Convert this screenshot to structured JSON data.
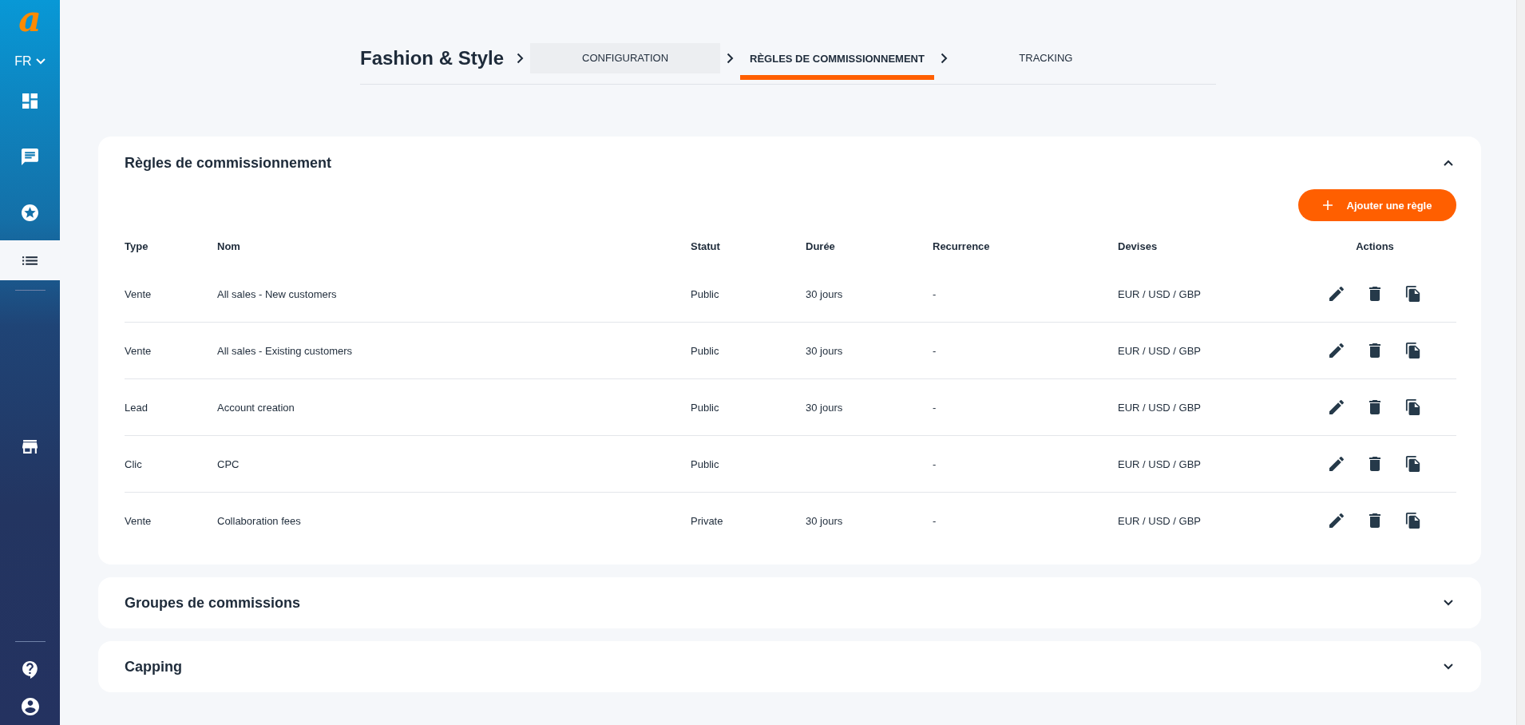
{
  "sidebar": {
    "logo": "a",
    "language": "FR",
    "nav": [
      {
        "selected": false
      },
      {
        "selected": false
      },
      {
        "selected": false
      },
      {
        "selected": true
      },
      {
        "selected": false
      }
    ]
  },
  "header": {
    "title": "Fashion & Style",
    "steps": [
      {
        "label": "CONFIGURATION",
        "selected": false,
        "highlighted": true
      },
      {
        "label": "RÈGLES DE COMMISSIONNEMENT",
        "selected": true,
        "highlighted": false
      },
      {
        "label": "TRACKING",
        "selected": false,
        "highlighted": false
      }
    ]
  },
  "sections": [
    {
      "title": "Règles de commissionnement",
      "expanded": true,
      "add_button": "Ajouter une règle",
      "table": {
        "columns": [
          "Type",
          "Nom",
          "Statut",
          "Durée",
          "Recurrence",
          "Devises",
          "Actions"
        ],
        "rows": [
          {
            "type": "Vente",
            "name": "All sales - New customers",
            "status": "Public",
            "duration": "30 jours",
            "recurrence": "-",
            "currencies": "EUR / USD / GBP"
          },
          {
            "type": "Vente",
            "name": "All sales - Existing customers",
            "status": "Public",
            "duration": "30 jours",
            "recurrence": "-",
            "currencies": "EUR / USD / GBP"
          },
          {
            "type": "Lead",
            "name": "Account creation",
            "status": "Public",
            "duration": "30 jours",
            "recurrence": "-",
            "currencies": "EUR / USD / GBP"
          },
          {
            "type": "Clic",
            "name": "CPC",
            "status": "Public",
            "recurrence": "-",
            "currencies": "EUR / USD / GBP"
          },
          {
            "type": "Vente",
            "name": "Collaboration fees",
            "status": "Private",
            "duration": "30 jours",
            "recurrence": "-",
            "currencies": "EUR / USD / GBP"
          }
        ]
      }
    },
    {
      "title": "Groupes de commissions",
      "expanded": false
    },
    {
      "title": "Capping",
      "expanded": false
    }
  ]
}
